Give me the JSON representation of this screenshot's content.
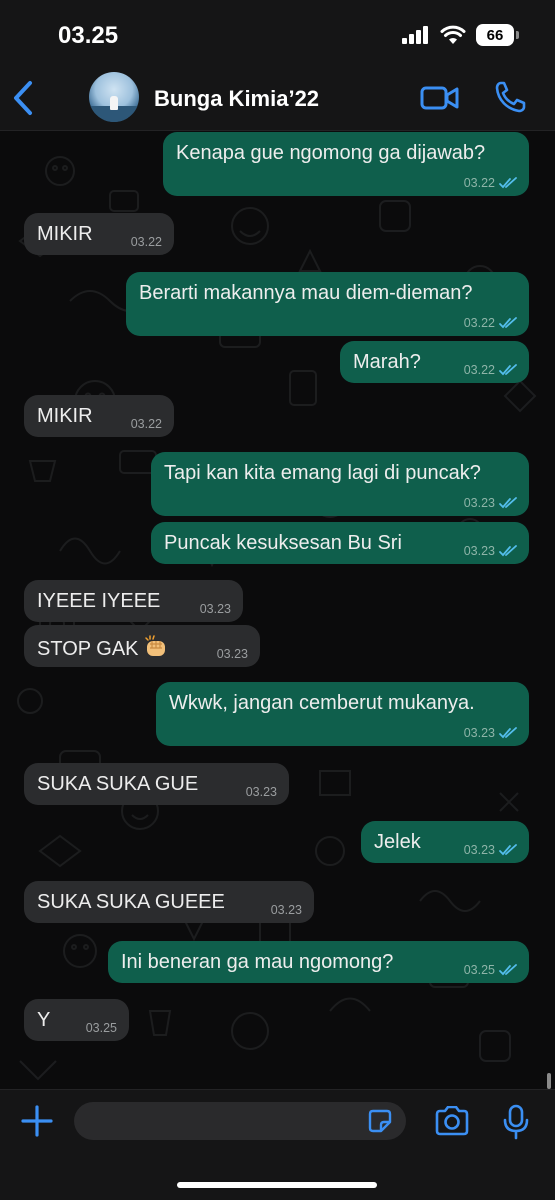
{
  "status": {
    "time": "03.25",
    "battery": "66"
  },
  "header": {
    "contact_name": "Bunga Kimia’22"
  },
  "messages": [
    {
      "dir": "out",
      "text": "Kenapa gue ngomong ga dijawab?",
      "time": "03.22",
      "read": true
    },
    {
      "dir": "in",
      "text": "MIKIR",
      "time": "03.22"
    },
    {
      "dir": "out",
      "text": "Berarti makannya mau diem-dieman?",
      "time": "03.22",
      "read": true
    },
    {
      "dir": "out",
      "text": "Marah?",
      "time": "03.22",
      "read": true
    },
    {
      "dir": "in",
      "text": "MIKIR",
      "time": "03.22"
    },
    {
      "dir": "out",
      "text": "Tapi kan kita emang lagi di puncak?",
      "time": "03.23",
      "read": true
    },
    {
      "dir": "out",
      "text": "Puncak kesuksesan Bu Sri",
      "time": "03.23",
      "read": true
    },
    {
      "dir": "in",
      "text": "IYEEE IYEEE",
      "time": "03.23"
    },
    {
      "dir": "in",
      "text": "STOP GAK",
      "time": "03.23",
      "emoji": "fist-icon"
    },
    {
      "dir": "out",
      "text": "Wkwk, jangan cemberut mukanya.",
      "time": "03.23",
      "read": true
    },
    {
      "dir": "in",
      "text": "SUKA SUKA GUE",
      "time": "03.23"
    },
    {
      "dir": "out",
      "text": "Jelek",
      "time": "03.23",
      "read": true
    },
    {
      "dir": "in",
      "text": "SUKA SUKA GUEEE",
      "time": "03.23"
    },
    {
      "dir": "out",
      "text": "Ini beneran ga mau ngomong?",
      "time": "03.25",
      "read": true
    },
    {
      "dir": "in",
      "text": "Y",
      "time": "03.25"
    }
  ],
  "composer": {
    "placeholder": ""
  },
  "colors": {
    "outgoing_bubble": "#0f5f4c",
    "incoming_bubble": "#2b2c2e",
    "accent_blue": "#3b8ff3",
    "read_ticks": "#53bdeb"
  }
}
